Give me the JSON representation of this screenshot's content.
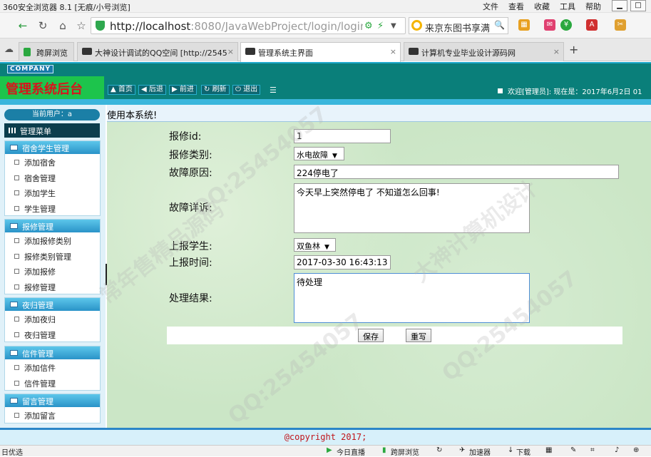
{
  "browser": {
    "window_title": "360安全浏览器 8.1 [无痕/小号浏览]",
    "menus": [
      "文件",
      "查看",
      "收藏",
      "工具",
      "帮助"
    ],
    "url_host": "http://localhost",
    "url_rest": ":8080/JavaWebProject/login/login_Che",
    "search_text": "来京东图书享满",
    "tabs": [
      {
        "label": "跨屏浏览",
        "active": false
      },
      {
        "label": "大神设计调试的QQ空间 [http://2545",
        "active": false
      },
      {
        "label": "管理系统主界面",
        "active": true
      },
      {
        "label": "计算机专业毕业设计源码网",
        "active": false
      }
    ]
  },
  "app": {
    "company": "COMPANY",
    "title": "管理系统后台",
    "nav": [
      "首页",
      "后退",
      "前进",
      "刷新",
      "退出"
    ],
    "welcome": "欢迎[管理员]:  现在是：2017年6月2日 01"
  },
  "sidebar": {
    "current_user": "当前用户：a",
    "menu_title": "管理菜单",
    "groups": [
      {
        "title": "宿舍学生管理",
        "items": [
          "添加宿舍",
          "宿舍管理",
          "添加学生",
          "学生管理"
        ]
      },
      {
        "title": "报修管理",
        "items": [
          "添加报修类别",
          "报修类别管理",
          "添加报修",
          "报修管理"
        ]
      },
      {
        "title": "夜归管理",
        "items": [
          "添加夜归",
          "夜归管理"
        ]
      },
      {
        "title": "信件管理",
        "items": [
          "添加信件",
          "信件管理"
        ]
      },
      {
        "title": "留言管理",
        "items": [
          "添加留言"
        ]
      }
    ]
  },
  "main": {
    "welcome_line": "使用本系统!",
    "form": {
      "repair_id_label": "报修id:",
      "repair_id_value": "1",
      "repair_type_label": "报修类别:",
      "repair_type_value": "水电故障",
      "fault_reason_label": "故障原因:",
      "fault_reason_value": "224停电了",
      "fault_detail_label": "故障详诉:",
      "fault_detail_value": "今天早上突然停电了 不知道怎么回事!",
      "reporter_label": "上报学生:",
      "reporter_value": "双鱼林",
      "report_time_label": "上报时间:",
      "report_time_value": "2017-03-30 16:43:13",
      "result_label": "处理结果:",
      "result_value": "待处理"
    },
    "buttons": {
      "save": "保存",
      "reset": "重写"
    }
  },
  "footer": {
    "copyright": "@copyright 2017;"
  },
  "statusbar": {
    "left": "日优选",
    "items": [
      "今日直播",
      "跨屏浏览",
      "加速器",
      "下载"
    ]
  },
  "watermarks": [
    "QQ:25454057",
    "大神计算机设计",
    "常年售精品源码"
  ]
}
